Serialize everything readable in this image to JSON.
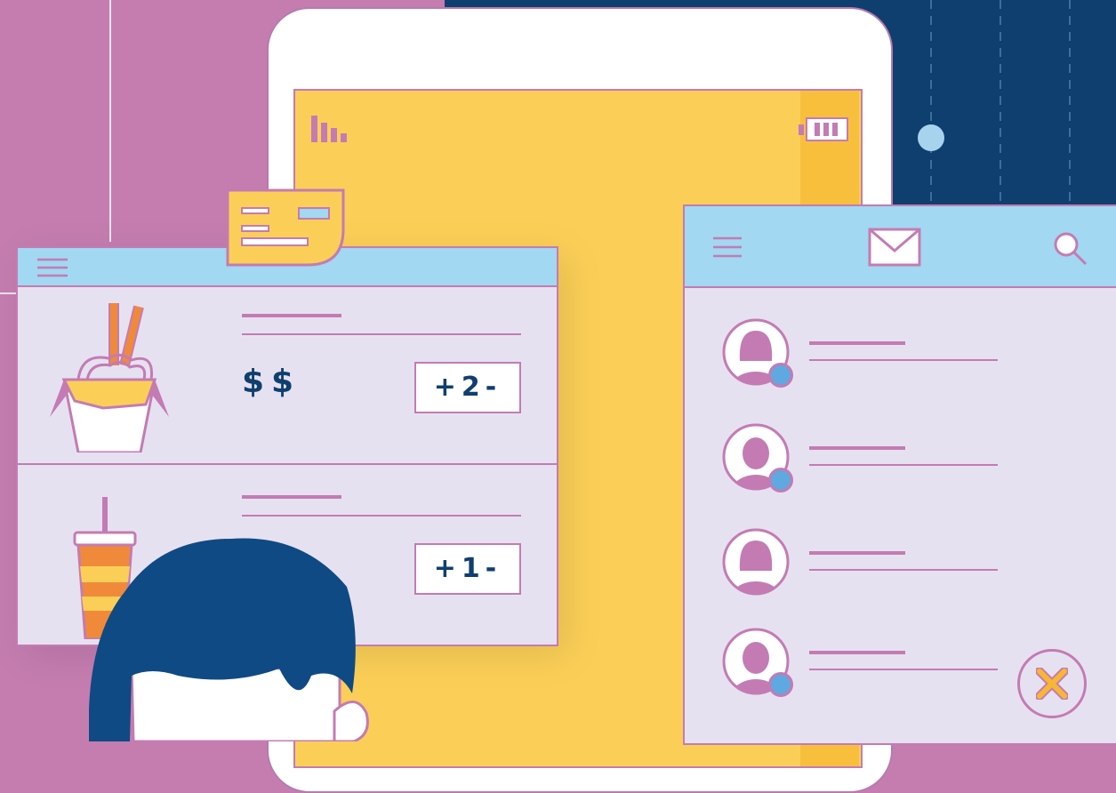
{
  "colors": {
    "pink_bg": "#c57db0",
    "navy_bg": "#0f3f6e",
    "tablet_screen": "#fbcf57",
    "panel": "#e6e1f1",
    "header": "#a2d8f1",
    "outline": "#c47bb3",
    "status_dot": "#5fa8e0",
    "close_x": "#f7b733"
  },
  "order_panel": {
    "items": [
      {
        "icon": "noodle-box-icon",
        "price": "$$",
        "quantity_label": "+2-"
      },
      {
        "icon": "drink-cup-icon",
        "quantity_label": "+1-"
      }
    ]
  },
  "messages_panel": {
    "header_icons": [
      "menu-icon",
      "mail-icon",
      "search-icon"
    ],
    "contacts": [
      {
        "avatar": "female-avatar-icon",
        "online": true
      },
      {
        "avatar": "male-avatar-icon",
        "online": true
      },
      {
        "avatar": "female-avatar-icon",
        "online": false
      },
      {
        "avatar": "male-avatar-icon",
        "online": true
      }
    ],
    "close_icon": "close-icon"
  },
  "tablet": {
    "status_icons": [
      "signal-icon",
      "battery-icon"
    ]
  }
}
